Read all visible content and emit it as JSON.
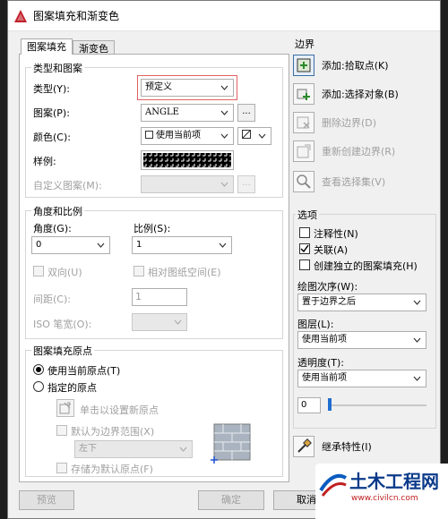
{
  "window": {
    "title": "图案填充和渐变色"
  },
  "tabs": {
    "hatch": "图案填充",
    "gradient": "渐变色"
  },
  "type_pattern": {
    "legend": "类型和图案",
    "type_label": "类型(Y):",
    "type_value": "预定义",
    "pattern_label": "图案(P):",
    "pattern_value": "ANGLE",
    "pattern_browse": "...",
    "color_label": "颜色(C):",
    "color_value": "使用当前项",
    "swatch_label": "样例:",
    "custom_label": "自定义图案(M):",
    "custom_browse": "..."
  },
  "angle_scale": {
    "legend": "角度和比例",
    "angle_label": "角度(G):",
    "angle_value": "0",
    "scale_label": "比例(S):",
    "scale_value": "1",
    "double_label": "双向(U)",
    "relative_label": "相对图纸空间(E)",
    "spacing_label": "间距(C):",
    "spacing_value": "1",
    "iso_label": "ISO 笔宽(O):"
  },
  "origin": {
    "legend": "图案填充原点",
    "current_label": "使用当前原点(T)",
    "specified_label": "指定的原点",
    "click_label": "单击以设置新原点",
    "default_extent_label": "默认为边界范围(X)",
    "extent_value": "左下",
    "store_label": "存储为默认原点(F)"
  },
  "boundary": {
    "legend": "边界",
    "add_pick": "添加:拾取点(K)",
    "add_select": "添加:选择对象(B)",
    "remove": "删除边界(D)",
    "recreate": "重新创建边界(R)",
    "view": "查看选择集(V)"
  },
  "options": {
    "legend": "选项",
    "annotative": "注释性(N)",
    "associative": "关联(A)",
    "separate": "创建独立的图案填充(H)",
    "draw_order_label": "绘图次序(W):",
    "draw_order_value": "置于边界之后",
    "layer_label": "图层(L):",
    "layer_value": "使用当前项",
    "transparency_label": "透明度(T):",
    "transparency_value": "使用当前项",
    "transparency_amount": "0"
  },
  "inherit": {
    "label": "继承特性(I)"
  },
  "buttons": {
    "preview": "预览",
    "ok": "确定",
    "cancel": "取消"
  },
  "watermark": {
    "title": "土木工程网",
    "url": "www.civilcn.com"
  },
  "colors": {
    "highlight": "#e06060",
    "accent": "#3a6ea5",
    "brand": "#0a3a8a"
  }
}
